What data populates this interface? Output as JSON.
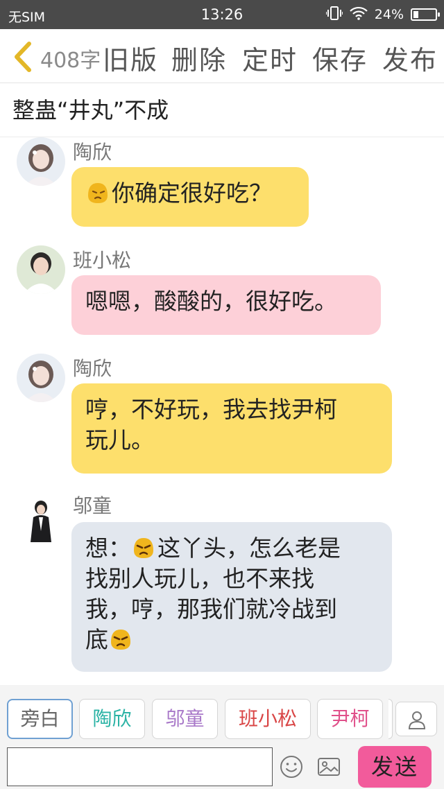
{
  "status_bar": {
    "carrier": "无SIM",
    "time": "13:26",
    "battery": "24%",
    "battery_level": 0.24
  },
  "toolbar": {
    "word_count": "408字",
    "old_version": "旧版",
    "delete": "删除",
    "timer": "定时",
    "save": "保存",
    "publish": "发布"
  },
  "title": "整蛊“井丸”不成",
  "messages": [
    {
      "sender": "陶欣",
      "emoji_before": "confused-face",
      "text": "你确定很好吃？",
      "color": "#fddf6c"
    },
    {
      "sender": "班小松",
      "text": "嗯嗯，酸酸的，很好吃。",
      "color": "#fdd0d8"
    },
    {
      "sender": "陶欣",
      "text_lines": [
        "哼，不好玩，我去找尹柯",
        "玩儿。"
      ],
      "color": "#fddf6c"
    },
    {
      "sender": "邬童",
      "text_line1": "这丫头，怎么老是",
      "line1_prefix": "想：",
      "text_lines": [
        "找别人玩儿，也不来找",
        "我，哼，那我们就冷战到"
      ],
      "last_line": "底",
      "emoji": "angry-face",
      "color": "#e2e7ee"
    }
  ],
  "roles": [
    {
      "label": "旁白",
      "color": "#666666"
    },
    {
      "label": "陶欣",
      "color": "#2bb3a5"
    },
    {
      "label": "邬童",
      "color": "#a979c9"
    },
    {
      "label": "班小松",
      "color": "#d94646"
    },
    {
      "label": "尹柯",
      "color": "#e0508a"
    }
  ],
  "input": {
    "value": "",
    "placeholder": ""
  },
  "send_label": "发送",
  "icons": {
    "back": "chevron-left-icon",
    "emoji": "smiley-icon",
    "image": "image-icon",
    "person": "person-icon"
  },
  "accent_colors": {
    "back_arrow": "#e3b728",
    "send_button": "#f25b9b"
  }
}
